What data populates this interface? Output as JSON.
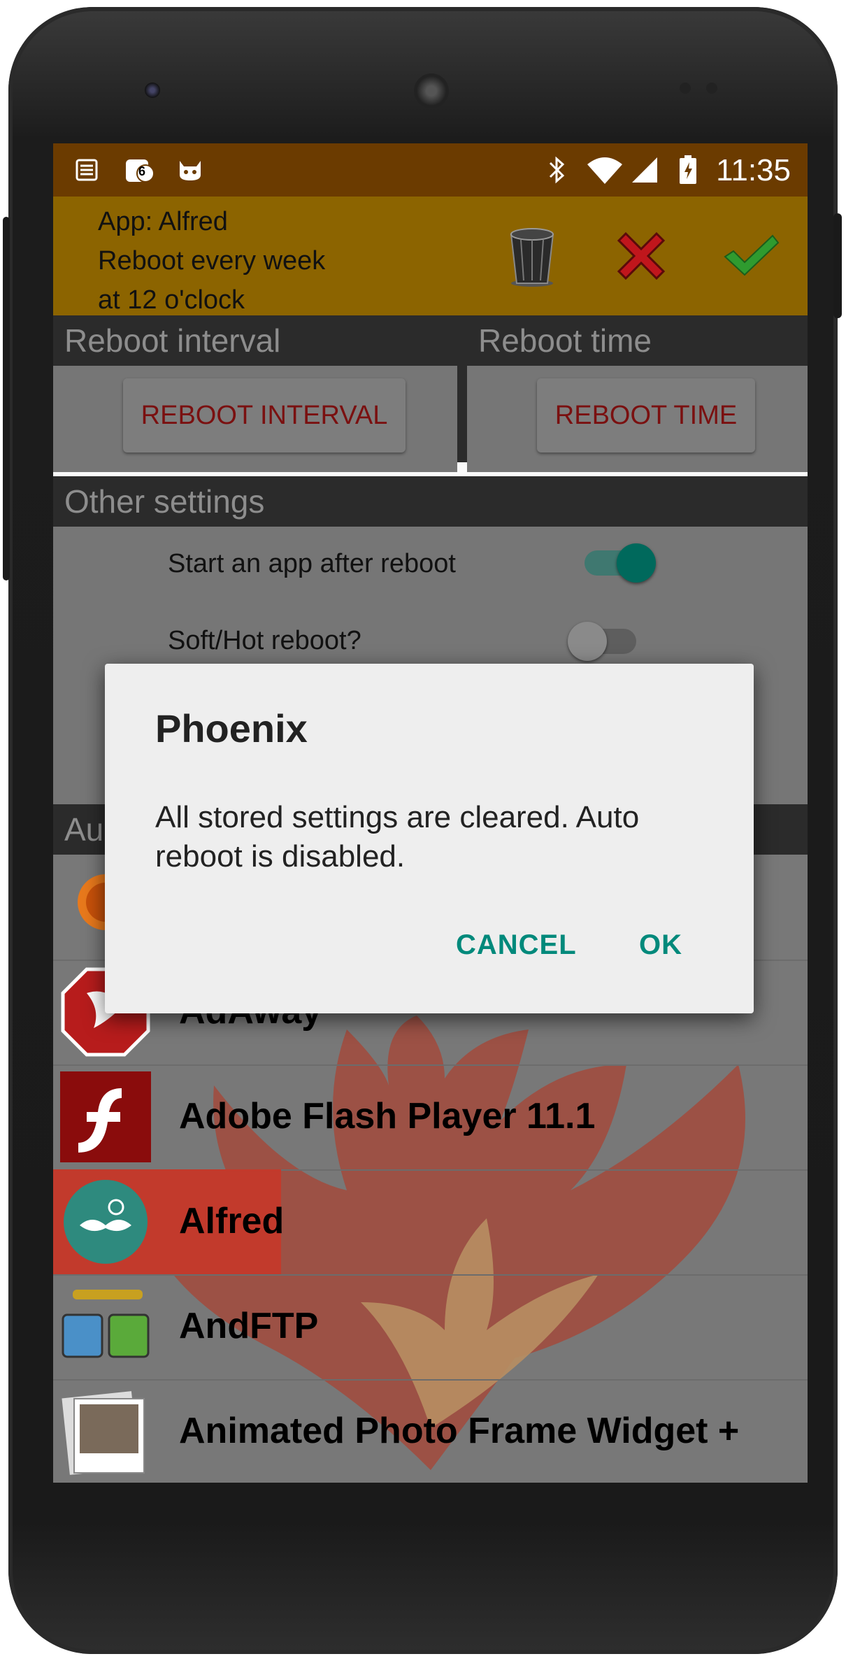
{
  "status_bar": {
    "time": "11:35",
    "left_icons": [
      "list-icon",
      "notification-badge-icon",
      "cat-icon"
    ],
    "notification_count": "6",
    "right_icons": [
      "bluetooth-icon",
      "wifi-icon",
      "signal-icon",
      "battery-icon"
    ]
  },
  "header": {
    "line1": "App: Alfred",
    "line2": "Reboot  every week",
    "line3": "at 12 o'clock",
    "actions": [
      "trash-icon",
      "cancel-x-icon",
      "confirm-check-icon"
    ]
  },
  "reboot_interval": {
    "section_title": "Reboot interval",
    "button_label": "REBOOT INTERVAL"
  },
  "reboot_time": {
    "section_title": "Reboot time",
    "button_label": "REBOOT TIME"
  },
  "other_settings": {
    "section_title": "Other settings",
    "start_app_label": "Start an app after reboot",
    "start_app_on": true,
    "soft_reboot_label": "Soft/Hot reboot?",
    "soft_reboot_on": false
  },
  "app_list": {
    "section_title_partial": "Au",
    "items": [
      {
        "label": "",
        "icon": "sun-app-icon"
      },
      {
        "label": "AdAway",
        "icon": "adaway-icon"
      },
      {
        "label": "Adobe Flash Player 11.1",
        "icon": "flash-player-icon"
      },
      {
        "label": "Alfred",
        "icon": "alfred-mustache-icon"
      },
      {
        "label": "AndFTP",
        "icon": "andftp-icon"
      },
      {
        "label": "Animated Photo Frame Widget +",
        "icon": "photo-frame-icon"
      }
    ]
  },
  "dialog": {
    "title": "Phoenix",
    "message": "All stored settings are cleared. Auto reboot is disabled.",
    "cancel_label": "CANCEL",
    "ok_label": "OK"
  },
  "colors": {
    "status_bar": "#6b3b00",
    "header": "#8c6400",
    "accent": "#00897b",
    "button_text": "#7a1010"
  }
}
